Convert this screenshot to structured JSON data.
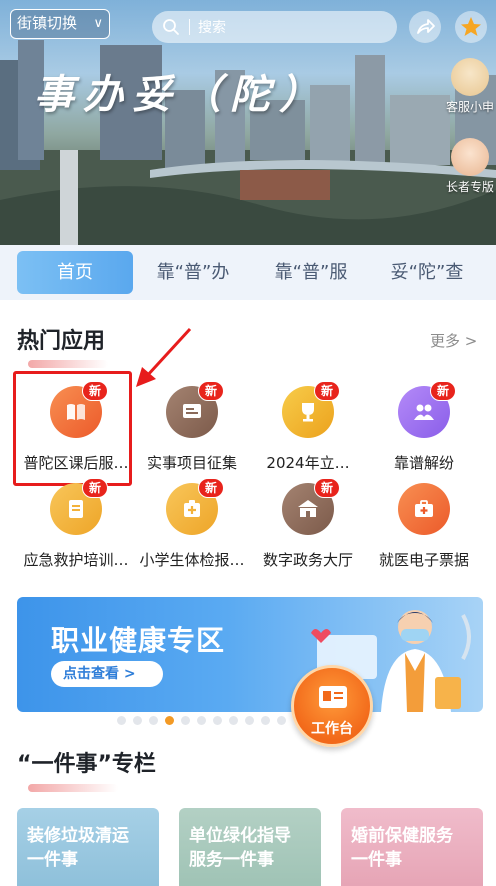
{
  "header": {
    "street_switch": "街镇切换",
    "search_placeholder": "搜索",
    "title": "事办妥（陀）",
    "side_widgets": [
      "客服小申",
      "长者专版"
    ]
  },
  "tabs": [
    {
      "label": "首页",
      "active": true
    },
    {
      "label": "靠“普”办",
      "active": false
    },
    {
      "label": "靠“普”服",
      "active": false
    },
    {
      "label": "妥“陀”查",
      "active": false
    }
  ],
  "hot_apps": {
    "title": "热门应用",
    "more": "更多 >",
    "badge": "新",
    "items": [
      {
        "label": "普陀区课后服…",
        "icon": "book-icon",
        "color": "#f26f3a",
        "new": true
      },
      {
        "label": "实事项目征集",
        "icon": "board-icon",
        "color": "#8a6a5a",
        "new": true
      },
      {
        "label": "2024年立…",
        "icon": "trophy-icon",
        "color": "#f0b325",
        "new": true
      },
      {
        "label": "靠谱解纷",
        "icon": "people-icon",
        "color": "#9a6ef0",
        "new": true
      },
      {
        "label": "应急救护培训…",
        "icon": "certificate-icon",
        "color": "#f3b23a",
        "new": true
      },
      {
        "label": "小学生体检报…",
        "icon": "medical-box-icon",
        "color": "#f3b23a",
        "new": true
      },
      {
        "label": "数字政务大厅",
        "icon": "building-icon",
        "color": "#8a6a5a",
        "new": true
      },
      {
        "label": "就医电子票据",
        "icon": "medkit-icon",
        "color": "#f26f3a",
        "new": false
      }
    ]
  },
  "banner": {
    "title": "职业健康专区",
    "button": "点击查看 >",
    "active_index": 3,
    "count": 11
  },
  "workbench": "工作台",
  "special": {
    "title": "“一件事”专栏",
    "cards": [
      {
        "line1": "装修垃圾清运",
        "line2": "一件事",
        "color": "#9fcbe0"
      },
      {
        "line1": "单位绿化指导",
        "line2": "服务一件事",
        "color": "#a9c9bd"
      },
      {
        "line1": "婚前保健服务",
        "line2": "一件事",
        "color": "#ecb2c0"
      }
    ]
  }
}
